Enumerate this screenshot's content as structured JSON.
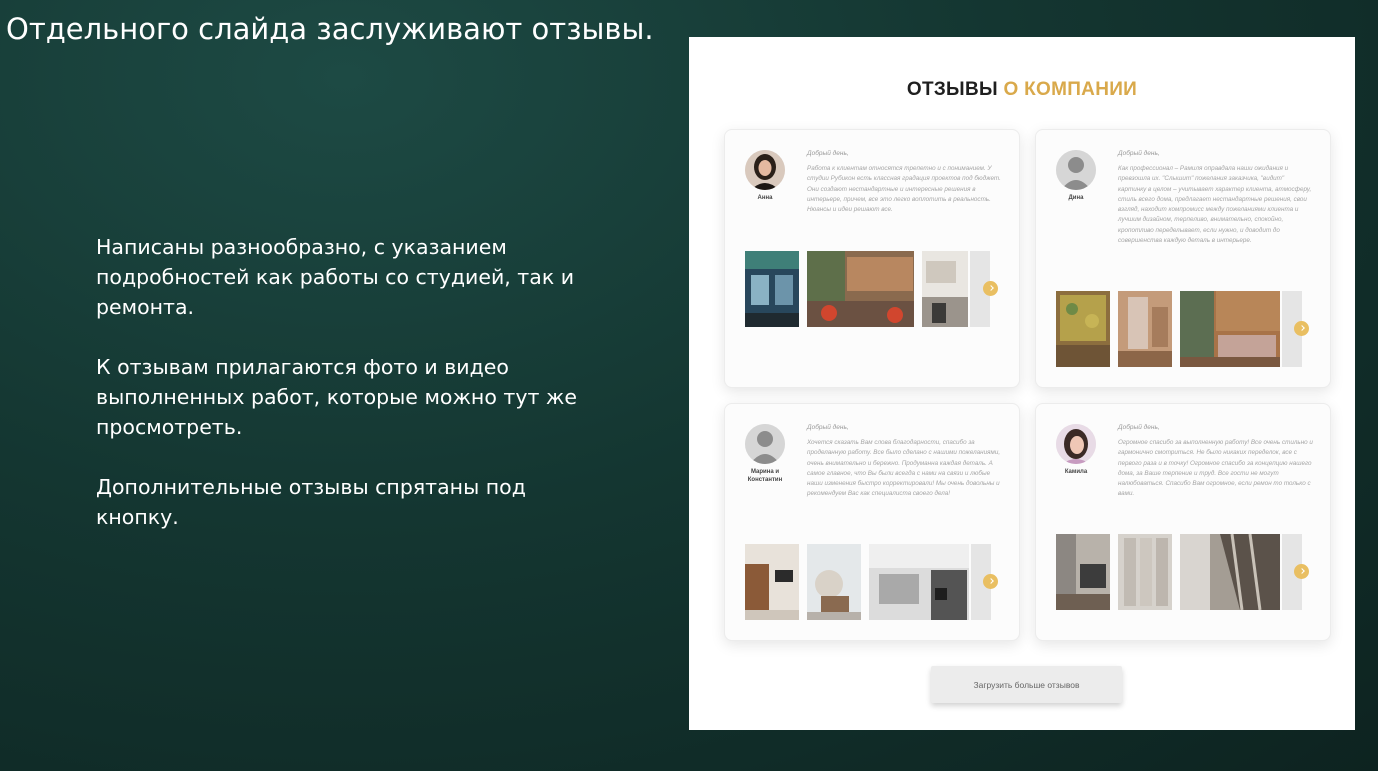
{
  "slide": {
    "title": "Отдельного слайда заслуживают отзывы.",
    "notes": [
      "Написаны разнообразно, с указанием подробностей как работы со студией, так и ремонта.",
      "К отзывам прилагаются фото и видео выполненных работ, которые можно тут же просмотреть.",
      "Дополнительные отзывы спрятаны под кнопку."
    ]
  },
  "site": {
    "heading_dark": "ОТЗЫВЫ",
    "heading_accent": "О КОМПАНИИ",
    "accent_color": "#d9a94b",
    "reviews": [
      {
        "author": "Анна",
        "avatar": "photo-avatar",
        "greeting": "Добрый день,",
        "text": "Работа к клиентам относятся трепетно и с пониманием. У студии Рубикон есть классная градация проектов под бюджет. Они создают нестандартные и интересные решения в интерьере, причем, все это легко воплотить в реальность. Нюансы и идеи решают все."
      },
      {
        "author": "Дина",
        "avatar": "person-placeholder-icon",
        "greeting": "Добрый день,",
        "text": "Как профессионал – Рамиля оправдала наши ожидания и превзошла их. \"Слышит\" пожелания заказчика, \"видит\" картинку в целом – учитывает характер клиента, атмосферу, стиль всего дома, предлагает нестандартные решения, свои взгляд, находит компромисс между пожеланиями клиента и лучшим дизайном, терпеливо, внимательно, спокойно, кропотливо переделывает, если нужно, и доводит до совершенства каждую деталь в интерьере."
      },
      {
        "author": "Марина и Константин",
        "avatar": "person-placeholder-icon",
        "greeting": "Добрый день,",
        "text": "Хочется сказать Вам слова благодарности, спасибо за проделанную работу. Все было сделано с нашими пожеланиями, очень внимательно и бережно. Продуманна каждая деталь. А самое главное, что Вы были всегда с нами на связи и любые наши изменения быстро корректировали! Мы очень довольны и рекомендуем Вас как специалиста своего дела!"
      },
      {
        "author": "Камила",
        "avatar": "photo-avatar",
        "greeting": "Добрый день,",
        "text": "Огромное спасибо за выполненную работу! Все очень стильно и гармонично смотриться. Не было никаких переделок, все с первого раза и в точку! Огромное спасибо за концепцию нашего дома, за Ваше терпение и труд. Все гости не могут налюбоваться. Спасибо Вам огромное, если ремон то только с вами."
      }
    ],
    "load_more_label": "Загрузить больше отзывов"
  }
}
